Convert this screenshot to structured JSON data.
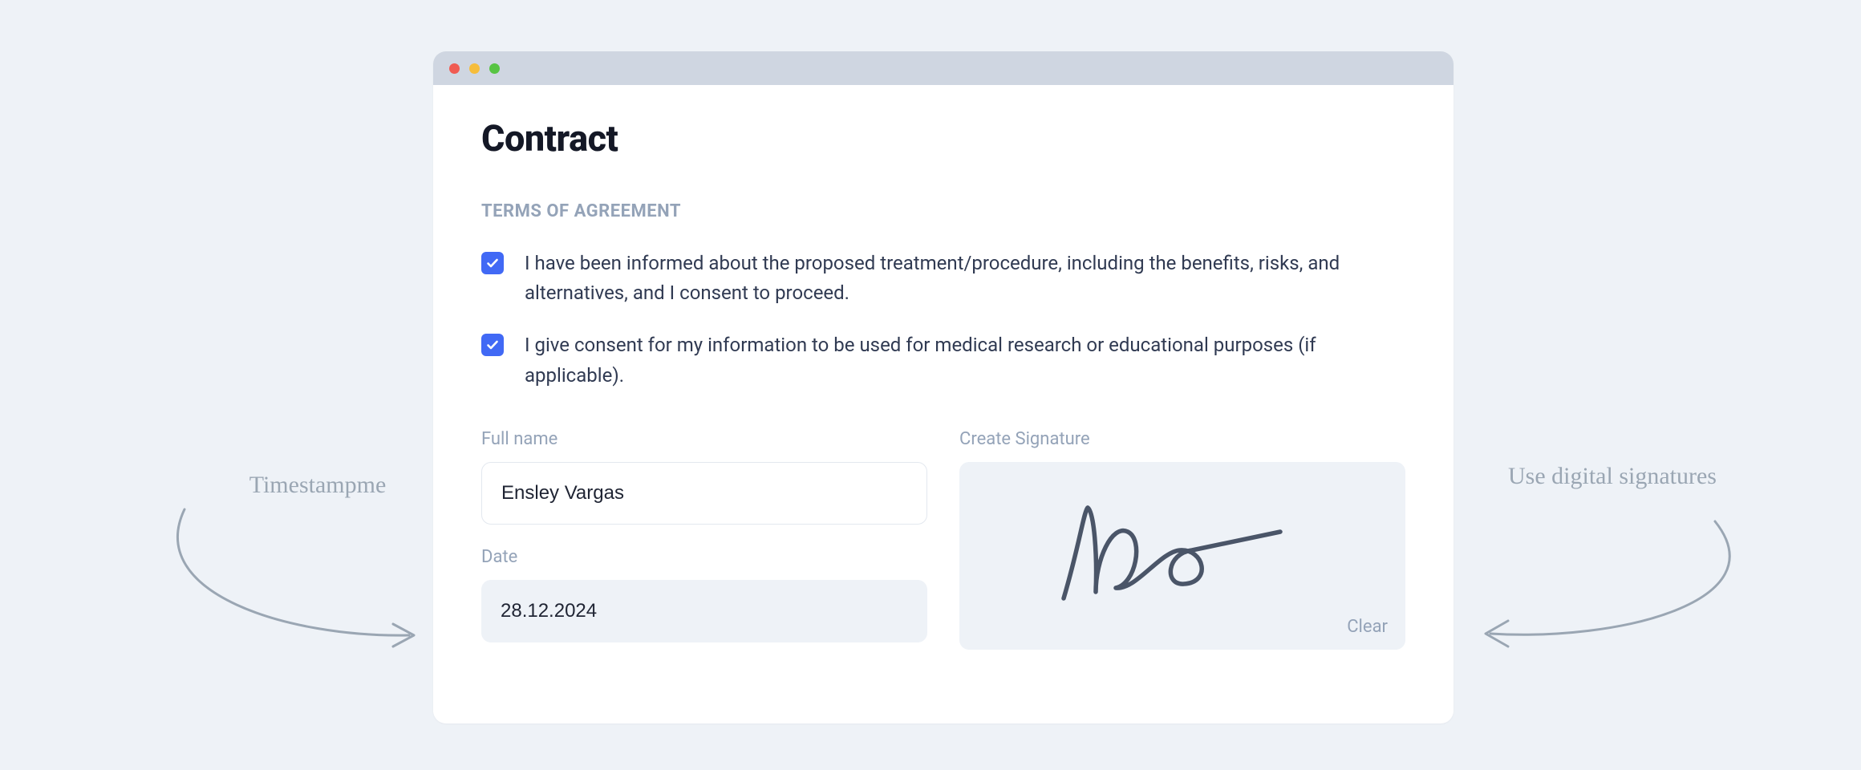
{
  "page": {
    "title": "Contract",
    "section_label": "TERMS OF AGREEMENT"
  },
  "terms": {
    "item1": "I have been informed about the proposed treatment/procedure, including the benefits, risks, and alternatives, and I consent to proceed.",
    "item2": "I give consent for my information to be used for medical research or educational purposes (if applicable)."
  },
  "form": {
    "full_name_label": "Full name",
    "full_name_value": "Ensley Vargas",
    "date_label": "Date",
    "date_value": "28.12.2024",
    "signature_label": "Create Signature",
    "clear_label": "Clear"
  },
  "annotations": {
    "left": "Timestampme",
    "right": "Use digital signatures"
  },
  "colors": {
    "accent": "#4169f5",
    "bg": "#eef2f7",
    "muted": "#94a3b8"
  }
}
